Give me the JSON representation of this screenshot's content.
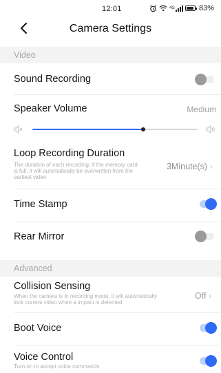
{
  "status_bar": {
    "time": "12:01",
    "network": "4G",
    "battery": "83%"
  },
  "nav": {
    "title": "Camera Settings",
    "back_icon": "chevron-left-icon"
  },
  "sections": {
    "video": {
      "header": "Video",
      "sound_recording": {
        "title": "Sound Recording",
        "enabled": false
      },
      "speaker_volume": {
        "title": "Speaker Volume",
        "value": "Medium",
        "level": 0.67
      },
      "loop_recording": {
        "title": "Loop Recording Duration",
        "desc_line1": "The duration of each recording, if the memory card",
        "desc_line2": "is full, it will automatically be overwritten from the",
        "desc_line3": "earliest video",
        "value": "3Minute(s)"
      },
      "time_stamp": {
        "title": "Time Stamp",
        "enabled": true
      },
      "rear_mirror": {
        "title": "Rear Mirror",
        "enabled": false
      }
    },
    "advanced": {
      "header": "Advanced",
      "collision_sensing": {
        "title": "Collision Sensing",
        "desc_line1": "When the camera is in recording mode, it will automatically",
        "desc_line2": "lock current video when a impact is detected",
        "value": "Off"
      },
      "boot_voice": {
        "title": "Boot Voice",
        "enabled": true
      },
      "voice_control": {
        "title": "Voice Control",
        "desc": "Turn on to accept voice commands",
        "enabled": true
      }
    }
  },
  "chevron": "›",
  "colors": {
    "accent": "#2f6cf5",
    "toggle_off_knob": "#9a9a9a",
    "section_bg": "#f3f3f3"
  }
}
